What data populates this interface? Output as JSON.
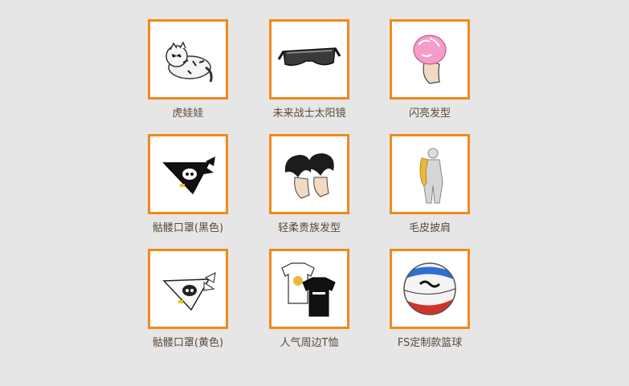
{
  "theme": {
    "border": "#f08a1c",
    "background": "#e6e6e6",
    "label_color": "#5b4a3a"
  },
  "items": [
    {
      "label": "虎娃娃",
      "icon": "tiger-plush"
    },
    {
      "label": "未来战士太阳镜",
      "icon": "future-sunglasses"
    },
    {
      "label": "闪亮发型",
      "icon": "pink-hairstyle"
    },
    {
      "label": "骷髅口罩(黑色)",
      "icon": "skull-mask-black"
    },
    {
      "label": "轻柔贵族发型",
      "icon": "noble-hairstyle"
    },
    {
      "label": "毛皮披肩",
      "icon": "fur-shawl"
    },
    {
      "label": "骷髅口罩(黄色)",
      "icon": "skull-mask-yellow"
    },
    {
      "label": "人气周边T恤",
      "icon": "tshirt"
    },
    {
      "label": "FS定制款篮球",
      "icon": "basketball"
    }
  ]
}
